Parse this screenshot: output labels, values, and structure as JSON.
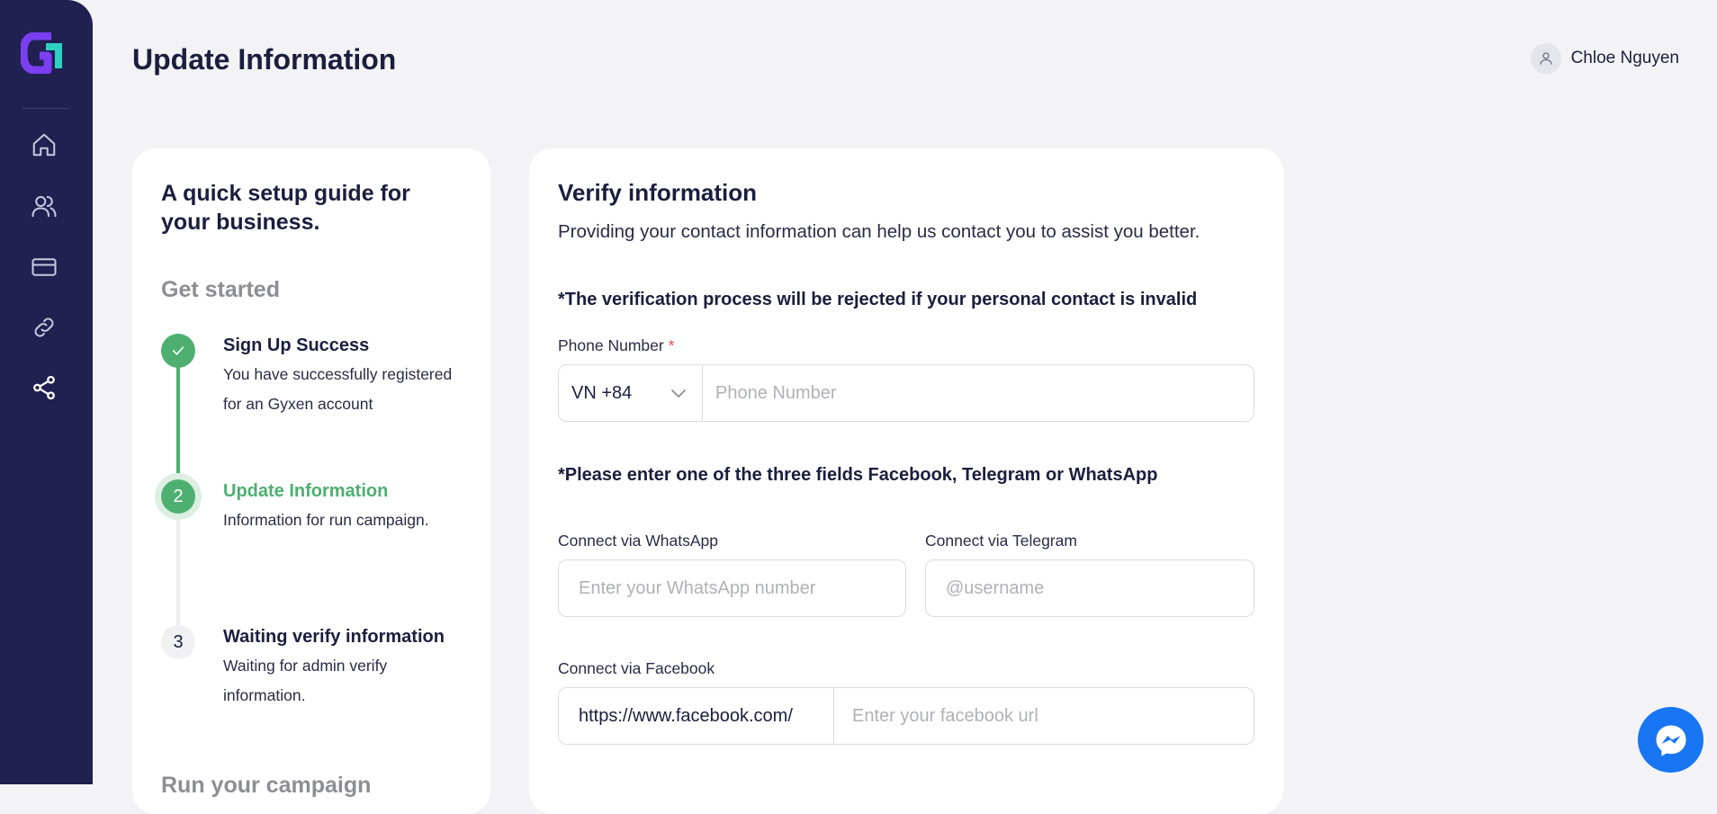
{
  "colors": {
    "sidebar": "#202150",
    "accent_green": "#4db070",
    "background": "#f3f3f6",
    "messenger_blue": "#1876f2"
  },
  "sidebar": {
    "logo": "gyxen-logo",
    "items": [
      {
        "icon": "home-icon"
      },
      {
        "icon": "users-icon"
      },
      {
        "icon": "credit-card-icon"
      },
      {
        "icon": "link-icon"
      },
      {
        "icon": "share-icon",
        "active": true
      }
    ]
  },
  "header": {
    "title": "Update Information"
  },
  "user": {
    "name": "Chloe Nguyen",
    "icon": "user-icon"
  },
  "guide": {
    "title": "A quick setup guide for your business.",
    "section_label": "Get started",
    "steps": [
      {
        "marker": "✓",
        "title": "Sign Up Success",
        "desc": "You have successfully registered for an Gyxen account",
        "status": "done"
      },
      {
        "marker": "2",
        "title": "Update Information",
        "desc": "Information for run campaign.",
        "status": "active"
      },
      {
        "marker": "3",
        "title": "Waiting verify information",
        "desc": "Waiting for admin verify information.",
        "status": "pending"
      }
    ],
    "next_section_label": "Run your campaign"
  },
  "verify": {
    "title": "Verify information",
    "subtitle": "Providing your contact information can help us contact you to assist you better.",
    "warning_contact": "*The verification process will be rejected if your personal contact is invalid",
    "phone": {
      "label": "Phone Number",
      "required_mark": "*",
      "country_code": "VN +84",
      "placeholder": "Phone Number"
    },
    "warning_social": "*Please enter one of the three fields Facebook, Telegram or WhatsApp",
    "whatsapp": {
      "label": "Connect via WhatsApp",
      "placeholder": "Enter your WhatsApp number"
    },
    "telegram": {
      "label": "Connect via Telegram",
      "placeholder": "@username"
    },
    "facebook": {
      "label": "Connect via Facebook",
      "prefix": "https://www.facebook.com/",
      "placeholder": "Enter your facebook url"
    }
  },
  "chat_widget": {
    "icon": "messenger-icon"
  }
}
